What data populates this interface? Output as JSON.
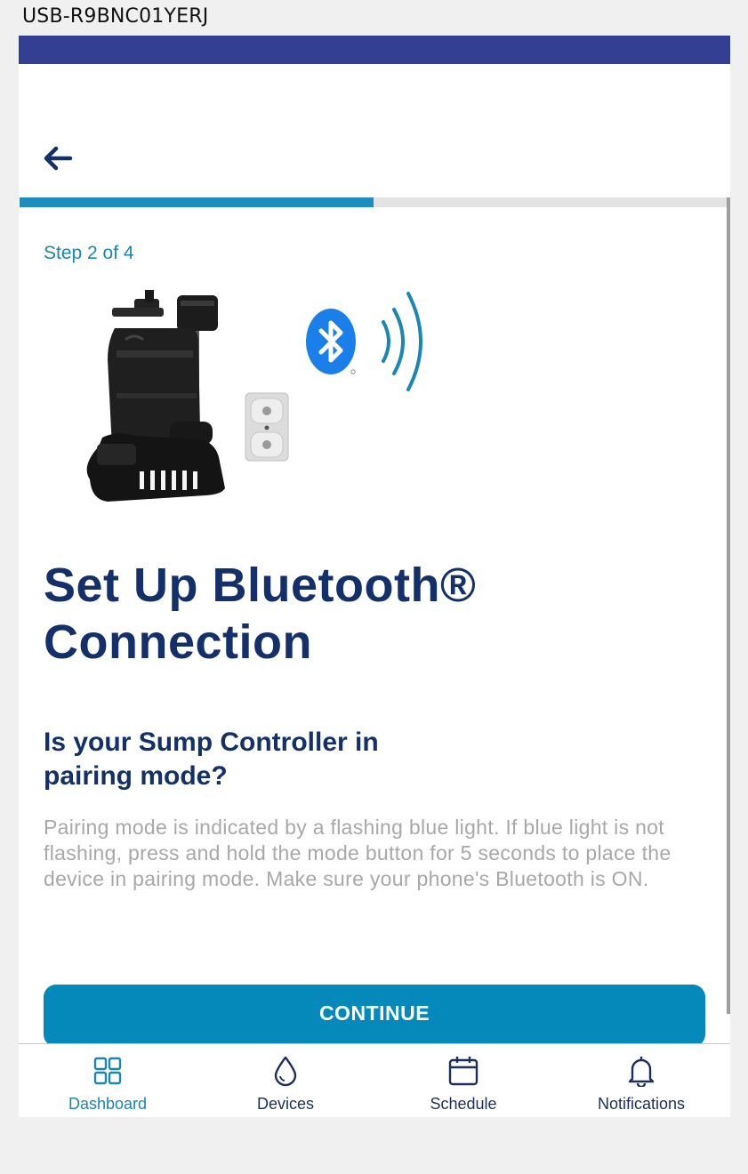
{
  "window": {
    "title": "USB-R9BNC01YERJ"
  },
  "header": {
    "back_icon": "arrow-left-icon"
  },
  "progress": {
    "step": 2,
    "total": 4,
    "fraction": 0.5
  },
  "content": {
    "step_label": "Step 2 of 4",
    "title": "Set Up Bluetooth® Connection",
    "question": "Is your Sump Controller in pairing mode?",
    "help_text": "Pairing mode is indicated by a flashing blue light. If blue light is not flashing, press and hold the mode button for 5 seconds to place the device in pairing mode. Make sure your phone's Bluetooth is ON."
  },
  "actions": {
    "continue_label": "CONTINUE"
  },
  "tab_bar": {
    "tabs": [
      {
        "label": "Dashboard",
        "icon": "dashboard-icon",
        "active": true
      },
      {
        "label": "Devices",
        "icon": "water-drop-icon",
        "active": false
      },
      {
        "label": "Schedule",
        "icon": "calendar-icon",
        "active": false
      },
      {
        "label": "Notifications",
        "icon": "bell-icon",
        "active": false
      }
    ]
  },
  "colors": {
    "status_bar": "#333f92",
    "accent": "#1a86b3",
    "button": "#0589bb",
    "title_text": "#14306a",
    "help_text": "#a8a8a8",
    "bluetooth_blue": "#1a7fe8"
  }
}
